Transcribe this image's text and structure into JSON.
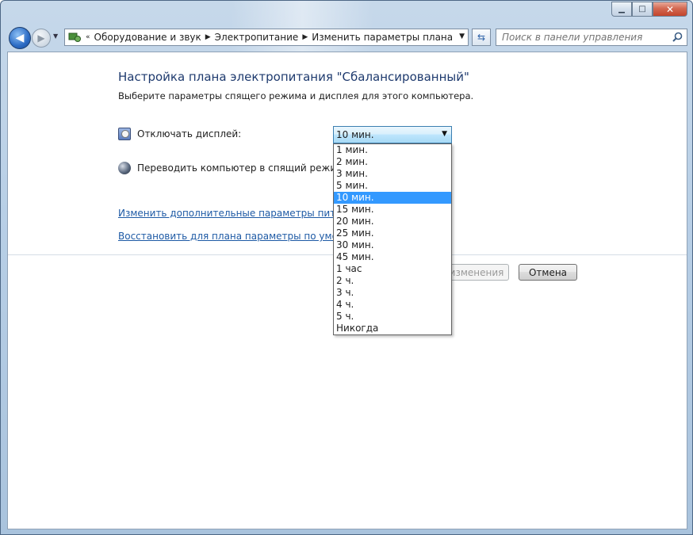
{
  "window": {
    "caption_buttons": {
      "minimize": "▁",
      "maximize": "□",
      "close": "✕"
    }
  },
  "navbar": {
    "back_glyph": "◀",
    "forward_glyph": "▶",
    "history_glyph": "▼",
    "address_prefix": "«",
    "breadcrumbs": [
      "Оборудование и звук",
      "Электропитание",
      "Изменить параметры плана"
    ],
    "crumb_separator": "▶",
    "address_dropdown_glyph": "▼",
    "refresh_glyph": "⇆",
    "search_placeholder": "Поиск в панели управления",
    "icons": {
      "back": "back-arrow-icon",
      "forward": "forward-arrow-icon",
      "address": "control-panel-icon",
      "search": "magnifier-icon"
    }
  },
  "page": {
    "title": "Настройка плана электропитания \"Сбалансированный\"",
    "subtitle": "Выберите параметры спящего режима и дисплея для этого компьютера."
  },
  "settings": {
    "display_off": {
      "label": "Отключать дисплей:",
      "selected": "10 мин.",
      "icon": "monitor-clock-icon"
    },
    "sleep": {
      "label": "Переводить компьютер в спящий режим:",
      "icon": "sleep-moon-icon"
    }
  },
  "dropdown": {
    "options": [
      "1 мин.",
      "2 мин.",
      "3 мин.",
      "5 мин.",
      "10 мин.",
      "15 мин.",
      "20 мин.",
      "25 мин.",
      "30 мин.",
      "45 мин.",
      "1 час",
      "2 ч.",
      "3 ч.",
      "4 ч.",
      "5 ч.",
      "Никогда"
    ],
    "selected_index": 4,
    "highlight_color": "#3399ff"
  },
  "links": {
    "advanced": "Изменить дополнительные параметры питания",
    "restore": "Восстановить для плана параметры по умолчанию"
  },
  "buttons": {
    "save_partial": "изменения",
    "cancel": "Отмена"
  }
}
